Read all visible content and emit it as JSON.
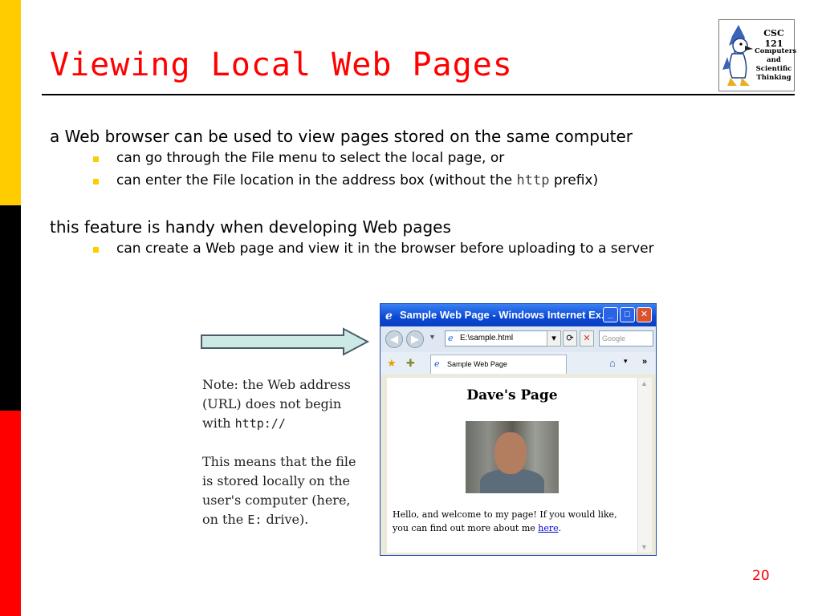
{
  "slide": {
    "title": "Viewing Local Web Pages",
    "page_number": "20",
    "logo": {
      "line1": "CSC 121",
      "line2a": "Computers",
      "line2b": "and",
      "line2c": "Scientific",
      "line2d": "Thinking"
    },
    "colors": {
      "bar_top": "#ffcc00",
      "bar_middle": "#000000",
      "bar_bottom": "#ff0000",
      "title": "#ff0000"
    }
  },
  "bullets": {
    "b1": "a Web browser can be used to view pages stored on the same computer",
    "b1_s1": "can go through the File menu to select the local page, or",
    "b1_s2_pre": "can enter the File location in the address box (without the ",
    "b1_s2_code": "http",
    "b1_s2_post": " prefix)",
    "b2": "this feature is handy when developing Web pages",
    "b2_s1": "can create a Web page and view it in the browser before uploading to a server"
  },
  "note": {
    "p1_pre": "Note: the Web address (URL) does not begin with ",
    "p1_code": "http://",
    "p2_pre": "This means that the file is stored locally on the user's computer (here, on the ",
    "p2_code": "E:",
    "p2_post": " drive)."
  },
  "browser": {
    "title": "Sample Web Page - Windows Internet Ex...",
    "address": "E:\\sample.html",
    "search_placeholder": "Google",
    "tab_label": "Sample Web Page",
    "page_heading": "Dave's Page",
    "body_pre": "Hello, and welcome to my page! If you would like, you can find out more about me ",
    "body_link": "here",
    "body_post": "."
  }
}
